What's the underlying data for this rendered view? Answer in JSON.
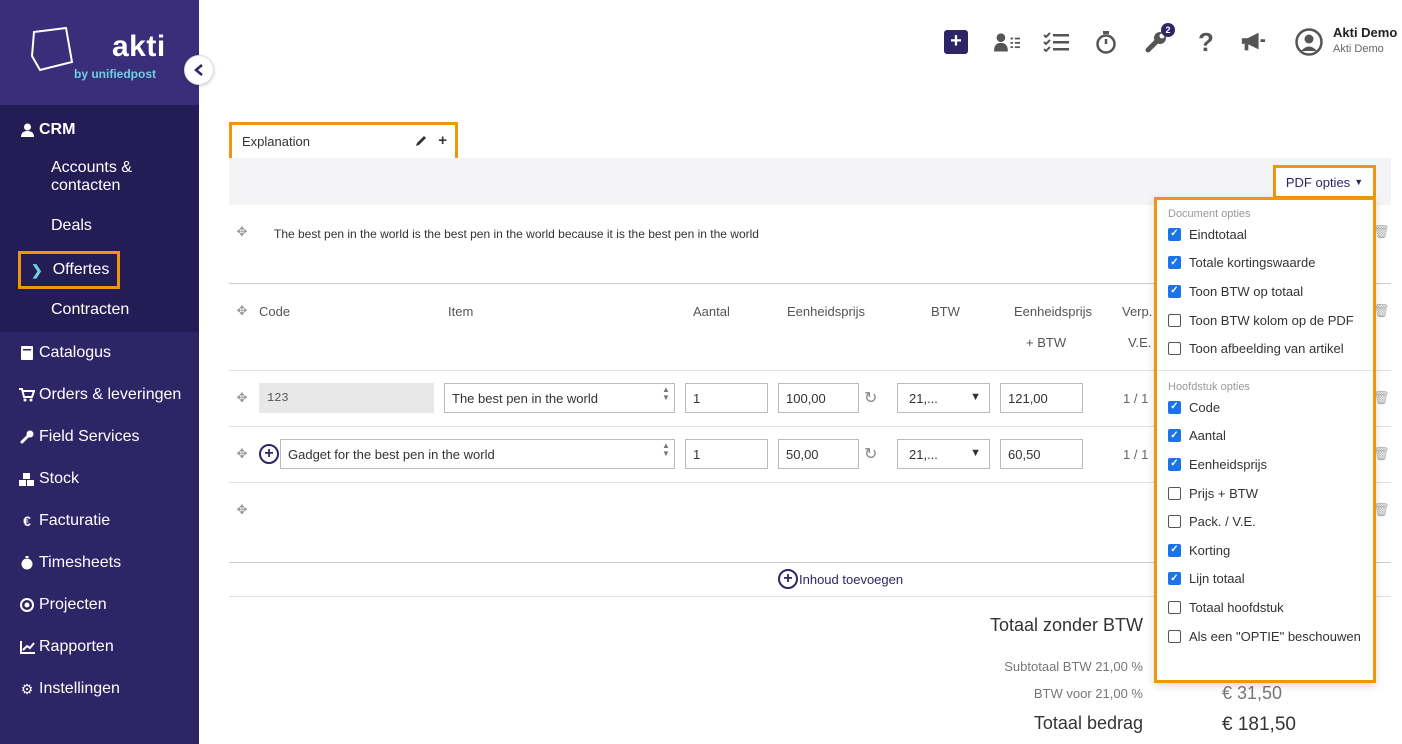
{
  "brand": {
    "name": "akti",
    "tagline": "by unifiedpost"
  },
  "sidebar": {
    "crm_label": "CRM",
    "crm_sub": [
      {
        "label": "Accounts & contacten"
      },
      {
        "label": "Deals"
      },
      {
        "label": "Offertes"
      },
      {
        "label": "Contracten"
      }
    ],
    "items": [
      {
        "label": "Catalogus",
        "icon": "book-icon"
      },
      {
        "label": "Orders & leveringen",
        "icon": "cart-icon"
      },
      {
        "label": "Field Services",
        "icon": "wrench-icon"
      },
      {
        "label": "Stock",
        "icon": "boxes-icon"
      },
      {
        "label": "Facturatie",
        "icon": "euro-icon"
      },
      {
        "label": "Timesheets",
        "icon": "stopwatch-icon"
      },
      {
        "label": "Projecten",
        "icon": "target-icon"
      },
      {
        "label": "Rapporten",
        "icon": "chart-icon"
      },
      {
        "label": "Instellingen",
        "icon": "gear-icon"
      }
    ]
  },
  "topbar": {
    "tools_badge": "2",
    "user_name": "Akti Demo",
    "user_company": "Akti Demo"
  },
  "section": {
    "title": "Explanation"
  },
  "pdf_options_label": "PDF opties",
  "description": "The best pen in the world is the best pen in the world because it is the best pen in the world",
  "columns": {
    "code": "Code",
    "item": "Item",
    "aantal": "Aantal",
    "eenheidsprijs": "Eenheidsprijs",
    "btw": "BTW",
    "eenheidsprijs_btw_1": "Eenheidsprijs",
    "eenheidsprijs_btw_2": "+ BTW",
    "verp_1": "Verp.",
    "verp_2": "V.E."
  },
  "rows": [
    {
      "code": "123",
      "item": "The best pen in the world",
      "aantal": "1",
      "prijs": "100,00",
      "btw": "21,...",
      "prijs_btw": "121,00",
      "verp": "1 / 1"
    },
    {
      "item": "Gadget for the best pen in the world",
      "aantal": "1",
      "prijs": "50,00",
      "btw": "21,...",
      "prijs_btw": "60,50",
      "verp": "1 / 1"
    }
  ],
  "add_content_label": "Inhoud toevoegen",
  "totals": {
    "excl_label": "Totaal zonder BTW",
    "subtotal_label": "Subtotaal  BTW 21,00 %",
    "vat_label": "BTW voor 21,00 %",
    "vat_value": "€ 31,50",
    "total_label": "Totaal bedrag",
    "total_value": "€ 181,50"
  },
  "dropdown": {
    "doc_header": "Document opties",
    "doc_options": [
      {
        "label": "Eindtotaal",
        "checked": true
      },
      {
        "label": "Totale kortingswaarde",
        "checked": true
      },
      {
        "label": "Toon BTW op totaal",
        "checked": true
      },
      {
        "label": "Toon BTW kolom op de PDF",
        "checked": false
      },
      {
        "label": "Toon afbeelding van artikel",
        "checked": false
      }
    ],
    "chapter_header": "Hoofdstuk opties",
    "chapter_options": [
      {
        "label": "Code",
        "checked": true
      },
      {
        "label": "Aantal",
        "checked": true
      },
      {
        "label": "Eenheidsprijs",
        "checked": true
      },
      {
        "label": "Prijs + BTW",
        "checked": false
      },
      {
        "label": "Pack. / V.E.",
        "checked": false
      },
      {
        "label": "Korting",
        "checked": true
      },
      {
        "label": "Lijn totaal",
        "checked": true
      },
      {
        "label": "Totaal hoofdstuk",
        "checked": false
      },
      {
        "label": "Als een \"OPTIE\" beschouwen",
        "checked": false
      }
    ]
  },
  "colors": {
    "sidebar": "#2e2566",
    "accent": "#f0960e",
    "checkbox": "#1a73e8"
  }
}
